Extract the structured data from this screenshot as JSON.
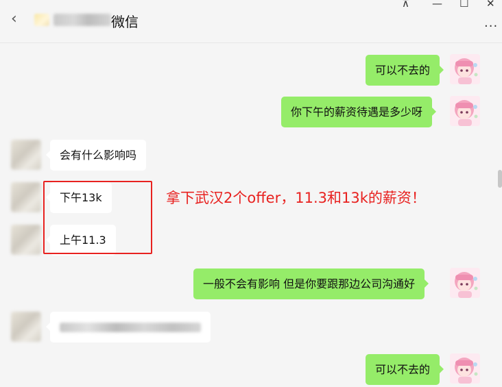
{
  "header": {
    "back_glyph": "‹",
    "title_suffix": "微信",
    "pin_glyph": "⊼",
    "min_glyph": "—",
    "max_glyph": "☐",
    "close_glyph": "✕",
    "more_glyph": "···"
  },
  "messages": [
    {
      "side": "self",
      "text": "可以不去的"
    },
    {
      "side": "self",
      "text": "你下午的薪资待遇是多少呀"
    },
    {
      "side": "other",
      "text": "会有什么影响吗"
    },
    {
      "side": "other",
      "text": "下午13k"
    },
    {
      "side": "other",
      "text": "上午11.3"
    },
    {
      "side": "self",
      "text": "一般不会有影响 但是你要跟那边公司沟通好"
    },
    {
      "side": "other",
      "text": ""
    },
    {
      "side": "self",
      "text": "可以不去的"
    }
  ],
  "annotation": "拿下武汉2个offer，11.3和13k的薪资！",
  "colors": {
    "self_bubble": "#95ec69",
    "other_bubble": "#ffffff",
    "annotation": "#e8211f",
    "background": "#f5f5f5"
  },
  "icons": [
    "back-icon",
    "pin-icon",
    "minimize-icon",
    "maximize-icon",
    "close-icon",
    "more-icon"
  ]
}
